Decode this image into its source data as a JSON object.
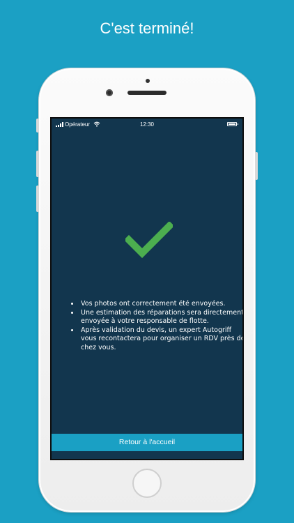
{
  "headline": "C'est terminé!",
  "status_bar": {
    "carrier": "Opérateur",
    "time": "12:30"
  },
  "icons": {
    "success": "checkmark-icon",
    "signal": "signal-icon",
    "wifi": "wifi-icon",
    "battery": "battery-icon"
  },
  "colors": {
    "background": "#1ba0c4",
    "screen": "#12364e",
    "check": "#4cae4f",
    "button": "#1aa0c4"
  },
  "messages": [
    "Vos photos ont correctement été envoyées.",
    "Une estimation des réparations sera directement envoyée à votre responsable de flotte.",
    "Après validation du devis, un expert Autogriff vous recontactera pour organiser un RDV près de chez vous."
  ],
  "button": {
    "label": "Retour à l'accueil"
  }
}
